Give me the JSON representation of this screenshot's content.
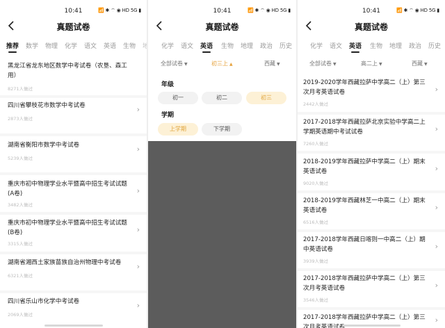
{
  "status_bar": {
    "time": "10:41",
    "icons": "📶 ✱ ⌔ ◉ HD 5G ▮"
  },
  "header": {
    "title": "真题试卷"
  },
  "panel1": {
    "tabs": [
      "推荐",
      "数学",
      "物理",
      "化学",
      "语文",
      "英语",
      "生物",
      "地"
    ],
    "active_tab": "推荐",
    "items": [
      {
        "title": "黑龙江省龙东地区数学中考试卷（农垦、森工用）",
        "count": "8271人做过"
      },
      {
        "title": "四川省攀枝花市数学中考试卷",
        "count": "2873人做过"
      },
      {
        "title": "湖南省衡阳市数学中考试卷",
        "count": "5239人做过"
      },
      {
        "title": "重庆市初中物理学业水平暨高中招生考试试题(A卷)",
        "count": "3482人做过"
      },
      {
        "title": "重庆市初中物理学业水平暨高中招生考试试题(B卷)",
        "count": "3315人做过"
      },
      {
        "title": "湖南省湘西土家族苗族自治州物理中考试卷",
        "count": "6321人做过"
      },
      {
        "title": "四川省乐山市化学中考试卷",
        "count": "2069人做过"
      }
    ]
  },
  "panel2": {
    "tabs": [
      "化学",
      "语文",
      "英语",
      "生物",
      "地理",
      "政治",
      "历史"
    ],
    "active_tab": "英语",
    "filters": {
      "type": "全部试卷",
      "grade": "初三上",
      "region": "西藏"
    },
    "section_grade": "年级",
    "grades": [
      "初一",
      "初二",
      "初三"
    ],
    "selected_grade": "初三",
    "section_term": "学期",
    "terms": [
      "上学期",
      "下学期"
    ],
    "selected_term": "上学期"
  },
  "panel3": {
    "tabs": [
      "化学",
      "语文",
      "英语",
      "生物",
      "地理",
      "政治",
      "历史"
    ],
    "active_tab": "英语",
    "filters": {
      "type": "全部试卷",
      "grade": "高二上",
      "region": "西藏"
    },
    "items": [
      {
        "title": "2019-2020学年西藏拉萨中学高二（上）第三次月考英语试卷",
        "count": "2442人做过"
      },
      {
        "title": "2017-2018学年西藏拉萨北京实验中学高二上学期英语期中考试试卷",
        "count": "7260人做过"
      },
      {
        "title": "2018-2019学年西藏拉萨中学高二（上）期末英语试卷",
        "count": "9020人做过"
      },
      {
        "title": "2018-2019学年西藏林芝一中高二（上）期末英语试卷",
        "count": "6516人做过"
      },
      {
        "title": "2017-2018学年西藏日喀则一中高二（上）期中英语试卷",
        "count": "3939人做过"
      },
      {
        "title": "2017-2018学年西藏拉萨中学高二（上）第三次月考英语试卷",
        "count": "3546人做过"
      },
      {
        "title": "2017-2018学年西藏拉萨中学高二（上）第三次月考英语试卷",
        "count": ""
      }
    ]
  }
}
